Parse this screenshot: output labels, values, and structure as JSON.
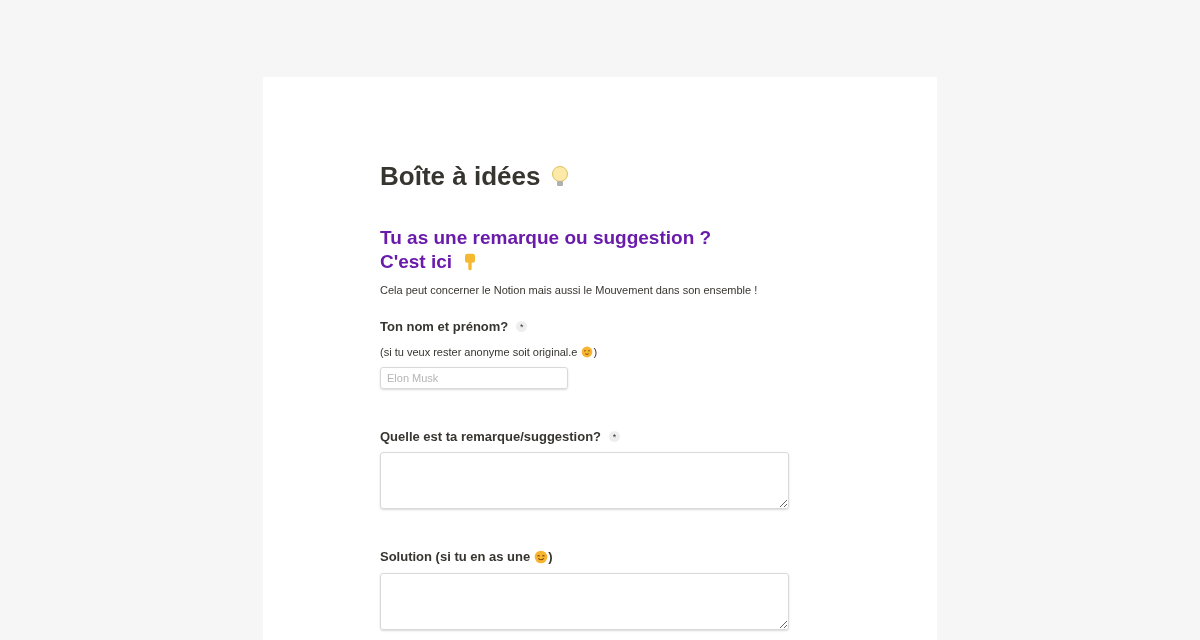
{
  "title": {
    "text": "Boîte à idées"
  },
  "heading": {
    "lines": [
      "Tu as une remarque ou suggestion ?",
      "C'est ici"
    ]
  },
  "description": "Cela peut concerner le Notion mais aussi le Mouvement dans son ensemble !",
  "questions": [
    {
      "kind": "input",
      "label": "Ton nom et prénom?",
      "required_mark": "*",
      "hint": "(si tu veux rester anonyme soit original.e",
      "hint_end": ")",
      "placeholder": "Elon Musk"
    },
    {
      "kind": "textarea",
      "label": "Quelle est ta remarque/suggestion?",
      "required_mark": "*"
    },
    {
      "kind": "textarea",
      "label": "Solution (si tu en as une",
      "label_end": ")"
    }
  ]
}
